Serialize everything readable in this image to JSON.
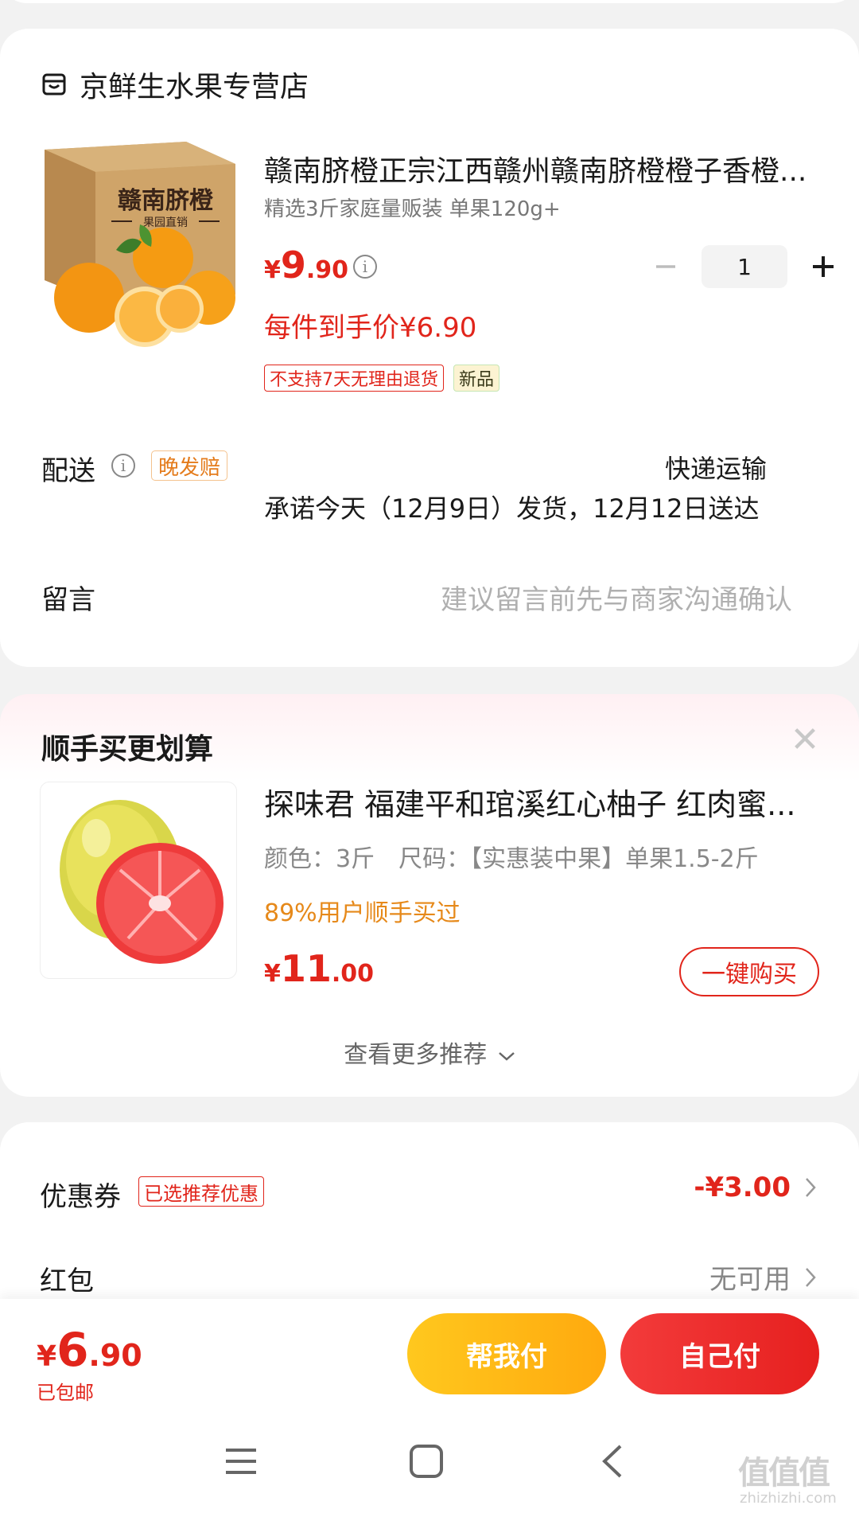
{
  "store": {
    "name": "京鲜生水果专营店"
  },
  "product": {
    "title": "赣南脐橙正宗江西赣州赣南脐橙橙子香橙...",
    "subtitle": "精选3斤家庭量贩装 单果120g+",
    "price_symbol": "¥",
    "price_int": "9",
    "price_dec": ".90",
    "quantity": "1",
    "deal_price": "每件到手价¥6.90",
    "tags": [
      "不支持7天无理由退货",
      "新品"
    ],
    "box_text": "赣南脐橙",
    "box_subtext": "果园直销"
  },
  "delivery": {
    "label": "配送",
    "delay_tag": "晚发赔",
    "method": "快递运输",
    "promise": "承诺今天（12月9日）发货，12月12日送达"
  },
  "message": {
    "label": "留言",
    "placeholder": "建议留言前先与商家沟通确认"
  },
  "recommend": {
    "title": "顺手买更划算",
    "item": {
      "name": "探味君 福建平和琯溪红心柚子 红肉蜜...",
      "spec": "颜色：3斤　尺码：【实惠装中果】单果1.5-2斤",
      "social": "89%用户顺手买过",
      "price_symbol": "¥",
      "price_int": "11",
      "price_dec": ".00",
      "buy_label": "一键购买"
    },
    "more_label": "查看更多推荐"
  },
  "coupon": {
    "label": "优惠券",
    "tag": "已选推荐优惠",
    "value": "-¥3.00"
  },
  "redpacket": {
    "label": "红包",
    "value": "无可用"
  },
  "checkout": {
    "price_symbol": "¥",
    "price_int": "6",
    "price_dec": ".90",
    "shipping": "已包邮",
    "help_pay_label": "帮我付",
    "self_pay_label": "自己付"
  },
  "watermark": {
    "text": "值值值",
    "url": "zhizhizhi.com"
  },
  "colors": {
    "accent": "#e1251b",
    "orange": "#e6891a",
    "yellow_button": "#ffb914"
  }
}
